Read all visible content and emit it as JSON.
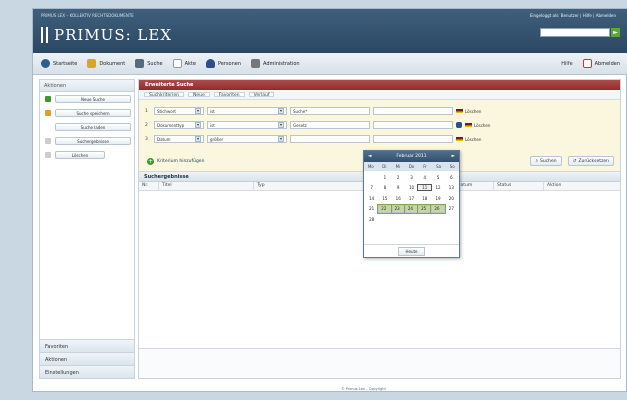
{
  "header": {
    "small_title": "PRIMUS LEX – KOLLEKTIV RECHTSDOKUMENTE",
    "user_text": "Eingeloggt als: Benutzer | Hilfe | Abmelden",
    "logo_text": "PRIMUS: LEX",
    "search_go": "►"
  },
  "toolbar": {
    "items": [
      {
        "label": "Startseite",
        "color": "#2b5f8f"
      },
      {
        "label": "Dokument",
        "color": "#d6a62a"
      },
      {
        "label": "Suche",
        "color": "#556b7f"
      },
      {
        "label": "Akte",
        "color": "#9a9a9a"
      },
      {
        "label": "Personen",
        "color": "#2d4f8a"
      },
      {
        "label": "Administration",
        "color": "#777"
      }
    ],
    "right_label": "Hilfe",
    "logout_label": "Abmelden"
  },
  "sidebar": {
    "title": "Aktionen",
    "rows": [
      {
        "button": "Neue Suche",
        "icon_color": "#3a9a2e"
      },
      {
        "button": "Suche speichern",
        "icon_color": "#e0a020"
      },
      {
        "button": "Suche laden",
        "icon_color": "#ffffff"
      },
      {
        "button": "Suchergebnisse",
        "icon_color": "#ffffff"
      },
      {
        "button": "Löschen",
        "icon_color": "#ffffff"
      }
    ],
    "bottom_items": [
      "Favoriten",
      "Aktionen",
      "Einstellungen"
    ]
  },
  "main": {
    "panel_title": "Erweiterte Suche",
    "tabs": [
      "Suchkriterien",
      "Neue",
      "Favoriten",
      "Verlauf"
    ],
    "filters": [
      {
        "num": "1",
        "field": "Stichwort",
        "op": "ist",
        "value": "Suche*",
        "extra": "Löschen"
      },
      {
        "num": "2",
        "field": "Dokumenttyp",
        "op": "ist",
        "value": "Gesetz",
        "extra": "Löschen"
      },
      {
        "num": "3",
        "field": "Datum",
        "op": "größer",
        "value": "",
        "extra": "Löschen"
      }
    ],
    "add_label": "Kriterium hinzufügen",
    "search_btn": "Suchen",
    "reset_btn": "Zurücksetzen",
    "results_title": "Suchergebnisse",
    "columns": [
      "Nr.",
      "Titel",
      "Typ",
      "Datum",
      "Status",
      "Aktion"
    ]
  },
  "calendar": {
    "title": "Februar 2011",
    "dow": [
      "Mo",
      "Di",
      "Mi",
      "Do",
      "Fr",
      "Sa",
      "So"
    ],
    "days": [
      "",
      "1",
      "2",
      "3",
      "4",
      "5",
      "6",
      "7",
      "8",
      "9",
      "10",
      "11",
      "12",
      "13",
      "14",
      "15",
      "16",
      "17",
      "18",
      "19",
      "20",
      "21",
      "22",
      "23",
      "24",
      "25",
      "26",
      "27",
      "28",
      "",
      "",
      "",
      "",
      "",
      ""
    ],
    "selected": [
      "22",
      "23",
      "24",
      "25",
      "26"
    ],
    "today": "11",
    "today_label": "Heute"
  },
  "footer_text": "© Primus Lex – Copyright"
}
